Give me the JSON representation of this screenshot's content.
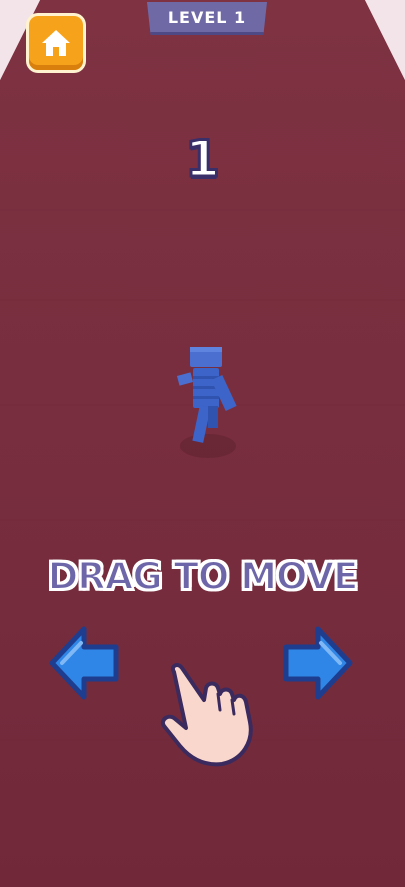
{
  "hud": {
    "level_label": "LEVEL 1",
    "counter": "1",
    "home_icon": "home-icon"
  },
  "tutorial": {
    "hint": "DRAG TO MOVE",
    "left_icon": "arrow-left-icon",
    "right_icon": "arrow-right-icon",
    "hand_icon": "hand-pointer-icon"
  },
  "colors": {
    "track": "#762d3b",
    "player": "#3d64c8",
    "hud_accent": "#6f6aa6",
    "home_button": "#f7a21b",
    "arrow": "#2f86e6"
  }
}
